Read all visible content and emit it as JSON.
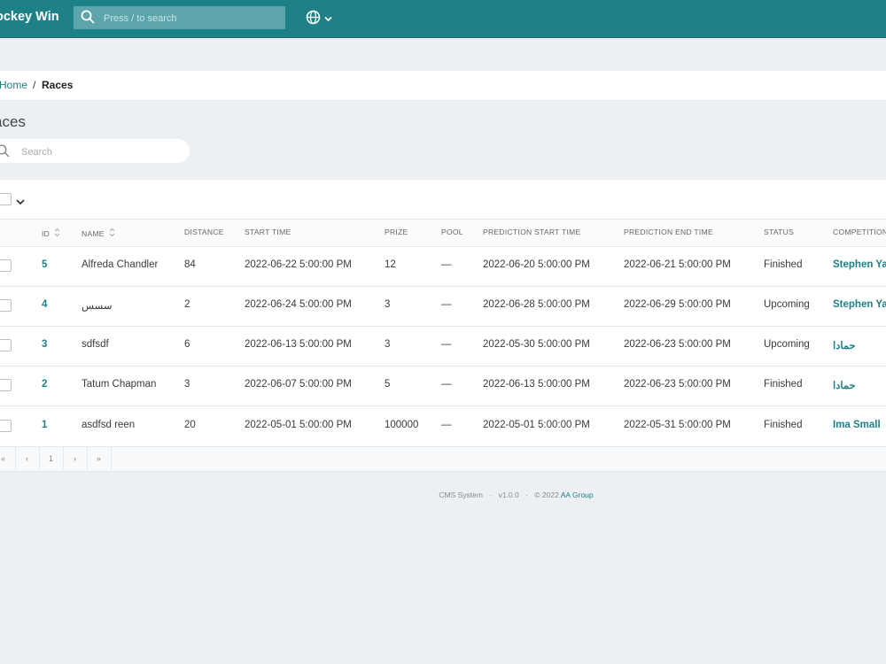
{
  "app": {
    "title": "ockey Win"
  },
  "topbar": {
    "search_placeholder": "Press / to search"
  },
  "breadcrumb": {
    "home": "Home",
    "separator": "/",
    "current": "Races"
  },
  "page": {
    "title": "aces",
    "search_placeholder": "Search"
  },
  "table": {
    "headers": {
      "id": "ID",
      "name": "NAME",
      "distance": "DISTANCE",
      "start_time": "START TIME",
      "prize": "PRIZE",
      "pool": "POOL",
      "prediction_start": "PREDICTION START TIME",
      "prediction_end": "PREDICTION END TIME",
      "status": "STATUS",
      "competition": "COMPETITION"
    },
    "rows": [
      {
        "id": "5",
        "name": "Alfreda Chandler",
        "distance": "84",
        "start_time": "2022-06-22 5:00:00 PM",
        "prize": "12",
        "pool": "—",
        "prediction_start": "2022-06-20 5:00:00 PM",
        "prediction_end": "2022-06-21 5:00:00 PM",
        "status": "Finished",
        "competition": "Stephen Yates"
      },
      {
        "id": "4",
        "name": "سسس",
        "distance": "2",
        "start_time": "2022-06-24 5:00:00 PM",
        "prize": "3",
        "pool": "—",
        "prediction_start": "2022-06-28 5:00:00 PM",
        "prediction_end": "2022-06-29 5:00:00 PM",
        "status": "Upcoming",
        "competition": "Stephen Yates"
      },
      {
        "id": "3",
        "name": "sdfsdf",
        "distance": "6",
        "start_time": "2022-06-13 5:00:00 PM",
        "prize": "3",
        "pool": "—",
        "prediction_start": "2022-05-30 5:00:00 PM",
        "prediction_end": "2022-06-23 5:00:00 PM",
        "status": "Upcoming",
        "competition": "حمادا"
      },
      {
        "id": "2",
        "name": "Tatum Chapman",
        "distance": "3",
        "start_time": "2022-06-07 5:00:00 PM",
        "prize": "5",
        "pool": "—",
        "prediction_start": "2022-06-13 5:00:00 PM",
        "prediction_end": "2022-06-23 5:00:00 PM",
        "status": "Finished",
        "competition": "حمادا"
      },
      {
        "id": "1",
        "name": "asdfsd reen",
        "distance": "20",
        "start_time": "2022-05-01 5:00:00 PM",
        "prize": "100000",
        "pool": "—",
        "prediction_start": "2022-05-01 5:00:00 PM",
        "prediction_end": "2022-05-31 5:00:00 PM",
        "status": "Finished",
        "competition": "Ima Small"
      }
    ]
  },
  "pagination": {
    "first": "«",
    "prev": "‹",
    "page": "1",
    "next": "›",
    "last": "»"
  },
  "footer": {
    "system": "CMS System",
    "dot1": "·",
    "version": "v1.0.0",
    "dot2": "·",
    "copyright": "© 2022",
    "company": "AA Group"
  },
  "colors": {
    "accent": "#1e8188",
    "background": "#edf0f3"
  },
  "icons": {
    "top_search": "search-icon",
    "language": "globe-icon",
    "chevron": "chevron-down-icon",
    "sort": "sort-icon"
  }
}
